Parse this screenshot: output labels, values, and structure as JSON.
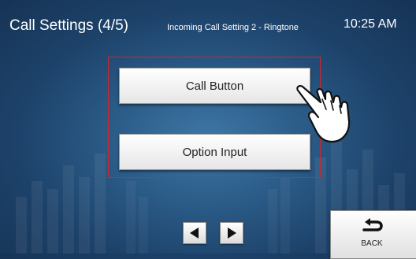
{
  "header": {
    "title": "Call Settings (4/5)",
    "subtitle": "Incoming Call Setting 2 - Ringtone",
    "time": "10:25 AM"
  },
  "buttons": {
    "call_button": "Call Button",
    "option_input": "Option Input"
  },
  "navigation": {
    "prev_icon": "triangle-left-icon",
    "next_icon": "triangle-right-icon",
    "back_label": "BACK",
    "back_icon": "return-arrow-icon"
  },
  "overlay": {
    "pointer": "pointing-hand-icon"
  },
  "colors": {
    "highlight_frame": "#d0262c",
    "background": "#2a5a86"
  }
}
